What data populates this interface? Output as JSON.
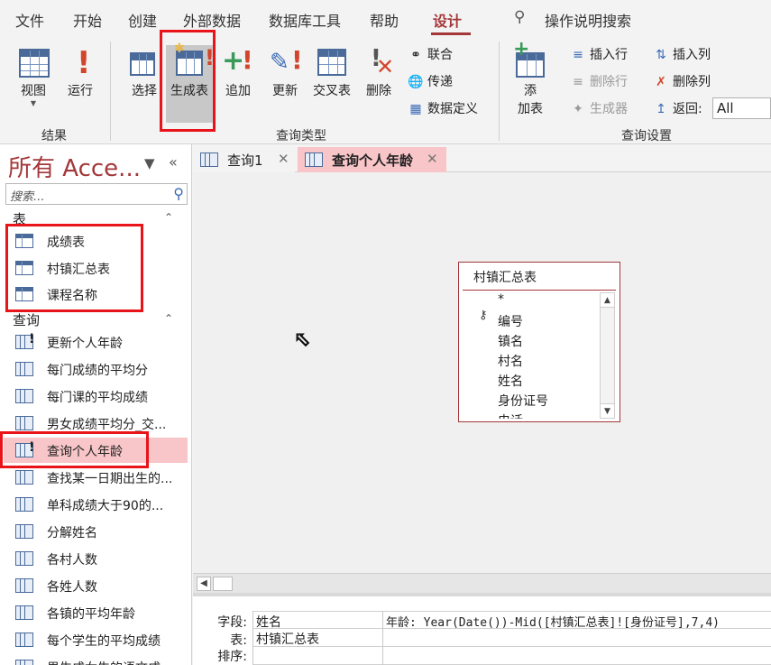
{
  "menubar": {
    "file": "文件",
    "start": "开始",
    "create": "创建",
    "external": "外部数据",
    "dbtools": "数据库工具",
    "help": "帮助",
    "design": "设计",
    "tellme": "操作说明搜索"
  },
  "ribbon": {
    "view": "视图",
    "run": "运行",
    "select": "选择",
    "maketable": "生成表",
    "append": "追加",
    "update": "更新",
    "crosstab": "交叉表",
    "delete": "删除",
    "union": "联合",
    "passthrough": "传递",
    "datadef": "数据定义",
    "addtable": [
      "添",
      "加表"
    ],
    "insert_row": "插入行",
    "delete_row": "删除行",
    "builder": "生成器",
    "insert_col": "插入列",
    "delete_col": "删除列",
    "return_label": "返回:",
    "return_value": "All",
    "group_results": "结果",
    "group_querytype": "查询类型",
    "group_setup": "查询设置"
  },
  "nav": {
    "title": "所有 Acce...",
    "search_placeholder": "搜索...",
    "tables_header": "表",
    "tables": [
      {
        "label": "成绩表"
      },
      {
        "label": "村镇汇总表"
      },
      {
        "label": "课程名称"
      }
    ],
    "queries_header": "查询",
    "queries": [
      {
        "label": "更新个人年龄"
      },
      {
        "label": "每门成绩的平均分"
      },
      {
        "label": "每门课的平均成绩"
      },
      {
        "label": "男女成绩平均分_交..."
      },
      {
        "label": "查询个人年龄"
      },
      {
        "label": "查找某一日期出生的..."
      },
      {
        "label": "单科成绩大于90的..."
      },
      {
        "label": "分解姓名"
      },
      {
        "label": "各村人数"
      },
      {
        "label": "各姓人数"
      },
      {
        "label": "各镇的平均年龄"
      },
      {
        "label": "每个学生的平均成绩"
      },
      {
        "label": "男生成女生的语文成"
      }
    ]
  },
  "tabs": [
    {
      "label": "查询1"
    },
    {
      "label": "查询个人年龄"
    }
  ],
  "table_box": {
    "title": "村镇汇总表",
    "fields": [
      "*",
      "编号",
      "镇名",
      "村名",
      "姓名",
      "身份证号",
      "电话"
    ]
  },
  "qbe": {
    "labels": {
      "field": "字段:",
      "table": "表:",
      "sort": "排序:"
    },
    "col1": {
      "field": "姓名",
      "table": "村镇汇总表"
    },
    "col2": {
      "field": "年龄: Year(Date())-Mid([村镇汇总表]![身份证号],7,4)"
    }
  },
  "colors": {
    "accent": "#a4373a",
    "selected": "#f8c5c8",
    "annotation": "#e8141a"
  }
}
